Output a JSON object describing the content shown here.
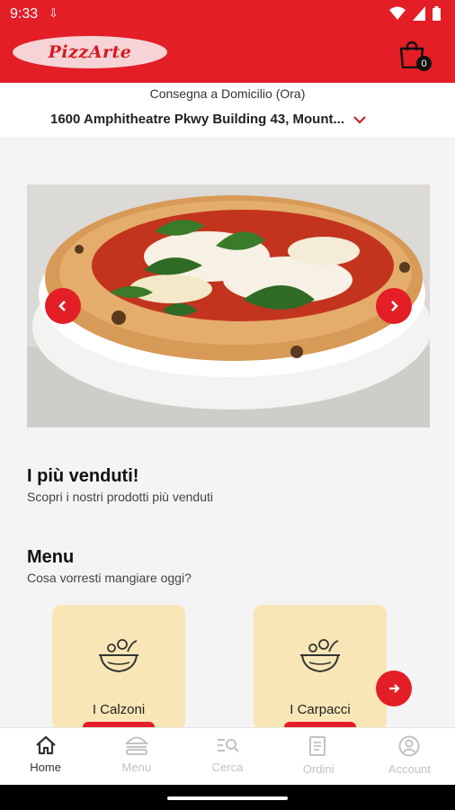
{
  "status_bar": {
    "time": "9:33"
  },
  "header": {
    "logo_text": "PizzArte",
    "cart_count": "0",
    "brand_color": "#e31e26"
  },
  "delivery": {
    "mode": "Consegna a Domicilio (Ora)",
    "address": "1600 Amphitheatre Pkwy Building 43, Mount..."
  },
  "bestsellers": {
    "title": "I più venduti!",
    "subtitle": "Scopri i nostri prodotti più venduti"
  },
  "menu": {
    "title": "Menu",
    "subtitle": "Cosa vorresti mangiare oggi?",
    "categories": [
      {
        "label": "I Calzoni",
        "icon": "food-bowl-icon"
      },
      {
        "label": "I Carpacci",
        "icon": "food-bowl-icon"
      }
    ]
  },
  "bottom_nav": [
    {
      "label": "Home",
      "icon": "home-icon",
      "active": true
    },
    {
      "label": "Menu",
      "icon": "burger-icon",
      "active": false
    },
    {
      "label": "Cerca",
      "icon": "search-list-icon",
      "active": false
    },
    {
      "label": "Ordini",
      "icon": "receipt-icon",
      "active": false
    },
    {
      "label": "Account",
      "icon": "account-icon",
      "active": false
    }
  ]
}
